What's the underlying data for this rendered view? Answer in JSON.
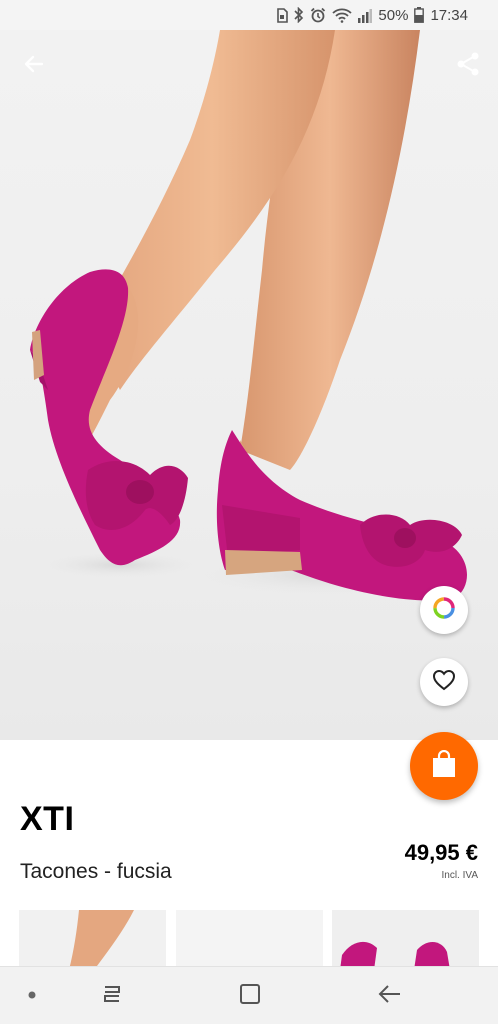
{
  "status_bar": {
    "battery_percent": "50%",
    "time": "17:34",
    "icons": [
      "sim-icon",
      "bluetooth-icon",
      "alarm-icon",
      "wifi-icon",
      "signal-icon",
      "battery-icon"
    ]
  },
  "hero": {
    "image_alt": "Pink suede low-heel pumps with bow",
    "actions": [
      "back-arrow-icon",
      "share-icon",
      "color-options-icon",
      "heart-icon"
    ]
  },
  "cart_button": {
    "icon": "shopping-bag-icon",
    "color": "#ff6900"
  },
  "product": {
    "brand": "XTI",
    "name": "Tacones - fucsia",
    "price": "49,95 €",
    "tax_note": "Incl. IVA"
  },
  "thumbnails": [
    "leg-shoe-thumb",
    "blank-thumb",
    "bow-detail-thumb"
  ],
  "nav_bar": {
    "buttons": [
      "recents-dot-icon",
      "recent-apps-icon",
      "home-icon",
      "back-icon"
    ]
  },
  "colors": {
    "accent": "#ff6900",
    "shoe": "#c2177d"
  }
}
